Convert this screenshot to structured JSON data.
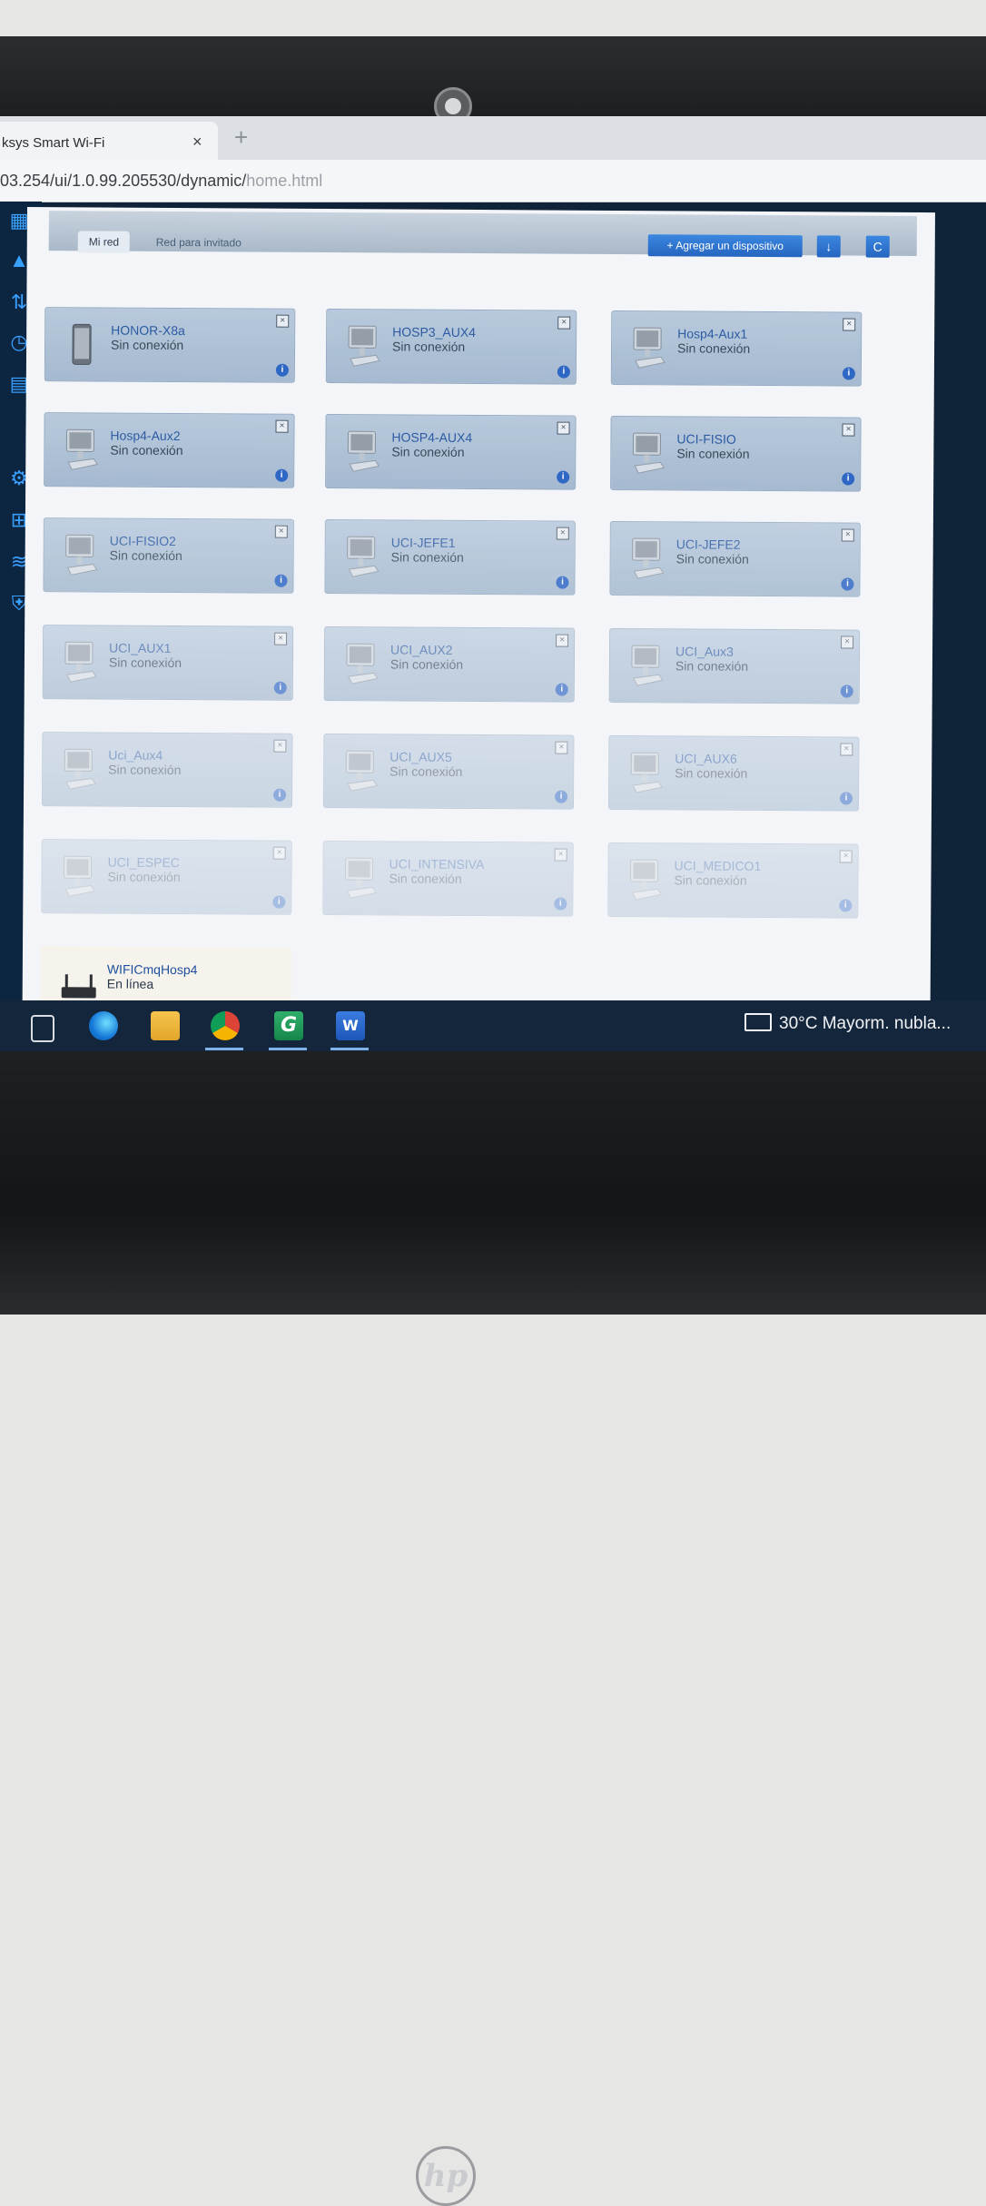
{
  "browser": {
    "tab_title": "ksys Smart Wi-Fi",
    "tab_close": "×",
    "new_tab": "+",
    "url": "03.254/ui/1.0.99.205530/dynamic/",
    "url_dim": "home.html"
  },
  "panel": {
    "tabs": [
      "Mi red",
      "Red para invitado"
    ],
    "add_device_label": "+ Agregar un dispositivo"
  },
  "devices": [
    {
      "name": "HONOR-X8a",
      "status": "Sin conexión",
      "icon": "phone-icon"
    },
    {
      "name": "HOSP3_AUX4",
      "status": "Sin conexión",
      "icon": "desktop-computer-icon"
    },
    {
      "name": "Hosp4-Aux1",
      "status": "Sin conexión",
      "icon": "desktop-computer-icon"
    },
    {
      "name": "Hosp4-Aux2",
      "status": "Sin conexión",
      "icon": "desktop-computer-icon"
    },
    {
      "name": "HOSP4-AUX4",
      "status": "Sin conexión",
      "icon": "desktop-computer-icon"
    },
    {
      "name": "UCI-FISIO",
      "status": "Sin conexión",
      "icon": "desktop-computer-icon"
    },
    {
      "name": "UCI-FISIO2",
      "status": "Sin conexión",
      "icon": "desktop-computer-icon"
    },
    {
      "name": "UCI-JEFE1",
      "status": "Sin conexión",
      "icon": "desktop-computer-icon"
    },
    {
      "name": "UCI-JEFE2",
      "status": "Sin conexión",
      "icon": "desktop-computer-icon"
    },
    {
      "name": "UCI_AUX1",
      "status": "Sin conexión",
      "icon": "desktop-computer-icon"
    },
    {
      "name": "UCI_AUX2",
      "status": "Sin conexión",
      "icon": "desktop-computer-icon"
    },
    {
      "name": "UCI_Aux3",
      "status": "Sin conexión",
      "icon": "desktop-computer-icon"
    },
    {
      "name": "Uci_Aux4",
      "status": "Sin conexión",
      "icon": "desktop-computer-icon"
    },
    {
      "name": "UCI_AUX5",
      "status": "Sin conexión",
      "icon": "desktop-computer-icon"
    },
    {
      "name": "UCI_AUX6",
      "status": "Sin conexión",
      "icon": "desktop-computer-icon"
    },
    {
      "name": "UCI_ESPEC",
      "status": "Sin conexión",
      "icon": "desktop-computer-icon"
    },
    {
      "name": "UCI_INTENSIVA",
      "status": "Sin conexión",
      "icon": "desktop-computer-icon"
    },
    {
      "name": "UCI_MEDICO1",
      "status": "Sin conexión",
      "icon": "desktop-computer-icon"
    },
    {
      "name": "WIFICmqHosp4",
      "status": "En línea",
      "icon": "router-icon"
    }
  ],
  "taskbar": {
    "weather": "30°C  Mayorm. nubla..."
  },
  "laptop": {
    "brand": "hp"
  }
}
